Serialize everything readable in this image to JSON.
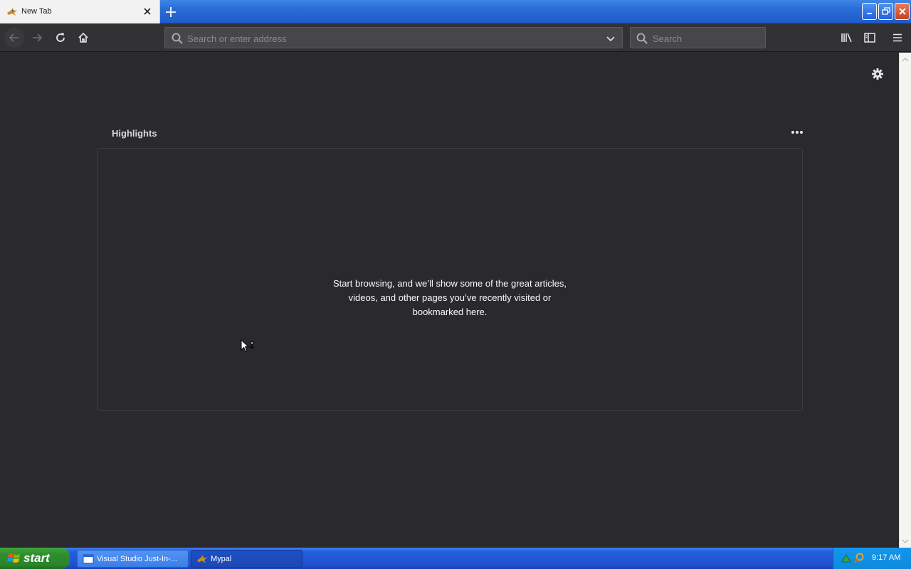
{
  "browser": {
    "tab": {
      "title": "New Tab"
    },
    "address_bar": {
      "value": "",
      "placeholder": "Search or enter address"
    },
    "search_bar": {
      "value": "",
      "placeholder": "Search"
    }
  },
  "new_tab_page": {
    "highlights": {
      "title": "Highlights",
      "empty_message_lines": [
        "Start browsing, and we’ll show some of the great articles,",
        "videos, and other pages you’ve recently visited or",
        "bookmarked here."
      ]
    }
  },
  "taskbar": {
    "start_label": "start",
    "tasks": [
      {
        "label": "Visual Studio Just-In-..."
      },
      {
        "label": "Mypal"
      }
    ],
    "clock": "9:17 AM"
  },
  "colors": {
    "page_background": "#2a2a2e",
    "toolbar": "#323234",
    "taskbar_blue": "#245edb",
    "start_green": "#2e8f2e"
  }
}
